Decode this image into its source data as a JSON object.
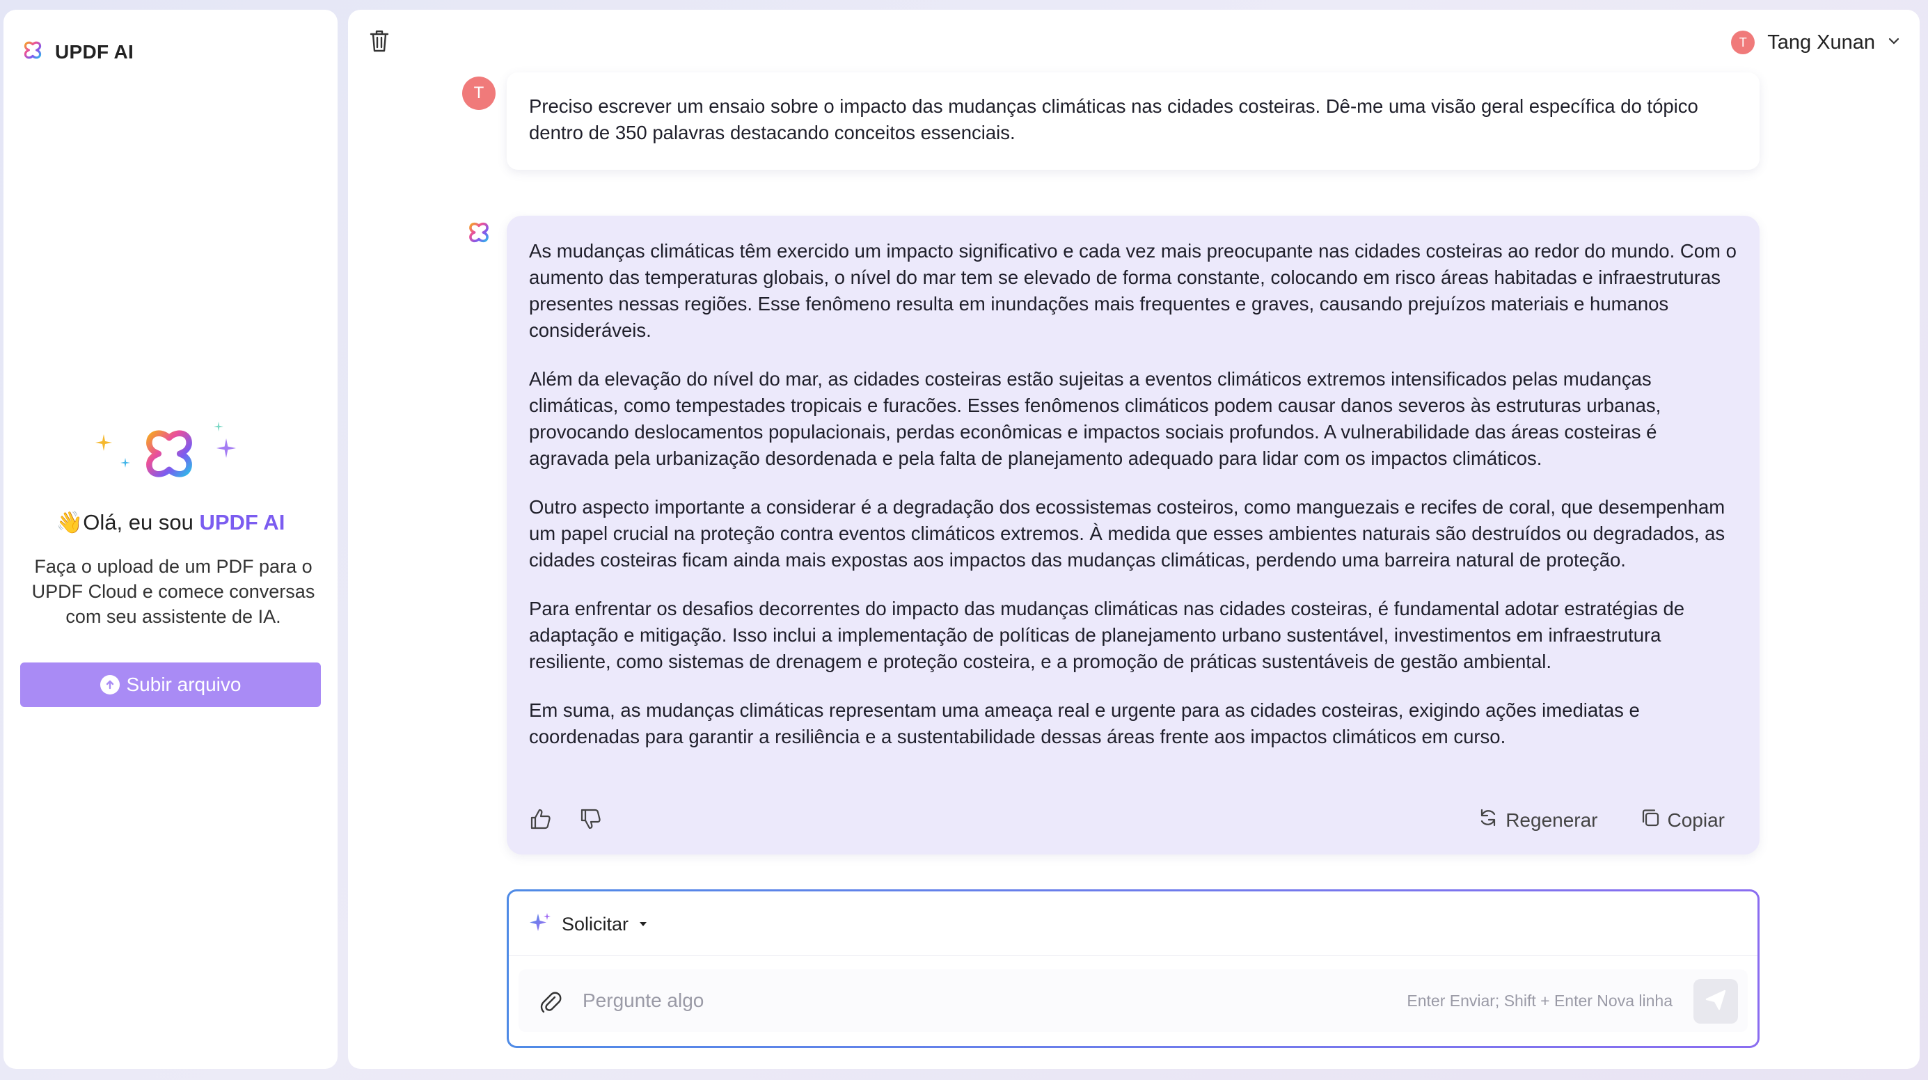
{
  "app": {
    "title": "UPDF AI"
  },
  "sidebar": {
    "greeting_emoji": "👋",
    "greeting_prefix": "Olá, eu sou ",
    "greeting_accent": "UPDF AI",
    "intro": "Faça o upload de um PDF para o UPDF Cloud e comece conversas com seu assistente de IA.",
    "upload_button": "Subir arquivo"
  },
  "header": {
    "user_initial": "T",
    "user_name": "Tang Xunan"
  },
  "chat": {
    "user_message": {
      "initial": "T",
      "text": "Preciso escrever um ensaio sobre o impacto das mudanças climáticas nas cidades costeiras. Dê-me uma visão geral específica do tópico dentro de 350 palavras destacando conceitos essenciais."
    },
    "ai_message": {
      "paragraphs": [
        "As mudanças climáticas têm exercido um impacto significativo e cada vez mais preocupante nas cidades costeiras ao redor do mundo. Com o aumento das temperaturas globais, o nível do mar tem se elevado de forma constante, colocando em risco áreas habitadas e infraestruturas presentes nessas regiões. Esse fenômeno resulta em inundações mais frequentes e graves, causando prejuízos materiais e humanos consideráveis.",
        "Além da elevação do nível do mar, as cidades costeiras estão sujeitas a eventos climáticos extremos intensificados pelas mudanças climáticas, como tempestades tropicais e furacões. Esses fenômenos climáticos podem causar danos severos às estruturas urbanas, provocando deslocamentos populacionais, perdas econômicas e impactos sociais profundos. A vulnerabilidade das áreas costeiras é agravada pela urbanização desordenada e pela falta de planejamento adequado para lidar com os impactos climáticos.",
        "Outro aspecto importante a considerar é a degradação dos ecossistemas costeiros, como manguezais e recifes de coral, que desempenham um papel crucial na proteção contra eventos climáticos extremos. À medida que esses ambientes naturais são destruídos ou degradados, as cidades costeiras ficam ainda mais expostas aos impactos das mudanças climáticas, perdendo uma barreira natural de proteção.",
        "Para enfrentar os desafios decorrentes do impacto das mudanças climáticas nas cidades costeiras, é fundamental adotar estratégias de adaptação e mitigação. Isso inclui a implementação de políticas de planejamento urbano sustentável, investimentos em infraestrutura resiliente, como sistemas de drenagem e proteção costeira, e a promoção de práticas sustentáveis de gestão ambiental.",
        "Em suma, as mudanças climáticas representam uma ameaça real e urgente para as cidades costeiras, exigindo ações imediatas e coordenadas para garantir a resiliência e a sustentabilidade dessas áreas frente aos impactos climáticos em curso."
      ],
      "regenerate_label": "Regenerar",
      "copy_label": "Copiar"
    }
  },
  "composer": {
    "prompt_label": "Solicitar",
    "placeholder": "Pergunte algo",
    "hint": "Enter Enviar; Shift + Enter Nova linha"
  },
  "colors": {
    "accent": "#7b5cf0",
    "upload_button": "#a98bf5",
    "avatar": "#f07a7a",
    "ai_bubble": "#ece9fb"
  },
  "icons": [
    "updf-logo-icon",
    "trash-icon",
    "chevron-down-icon",
    "thumbs-up-icon",
    "thumbs-down-icon",
    "refresh-icon",
    "copy-icon",
    "sparkle-icon",
    "caret-down-icon",
    "paperclip-icon",
    "send-icon",
    "upload-icon"
  ]
}
